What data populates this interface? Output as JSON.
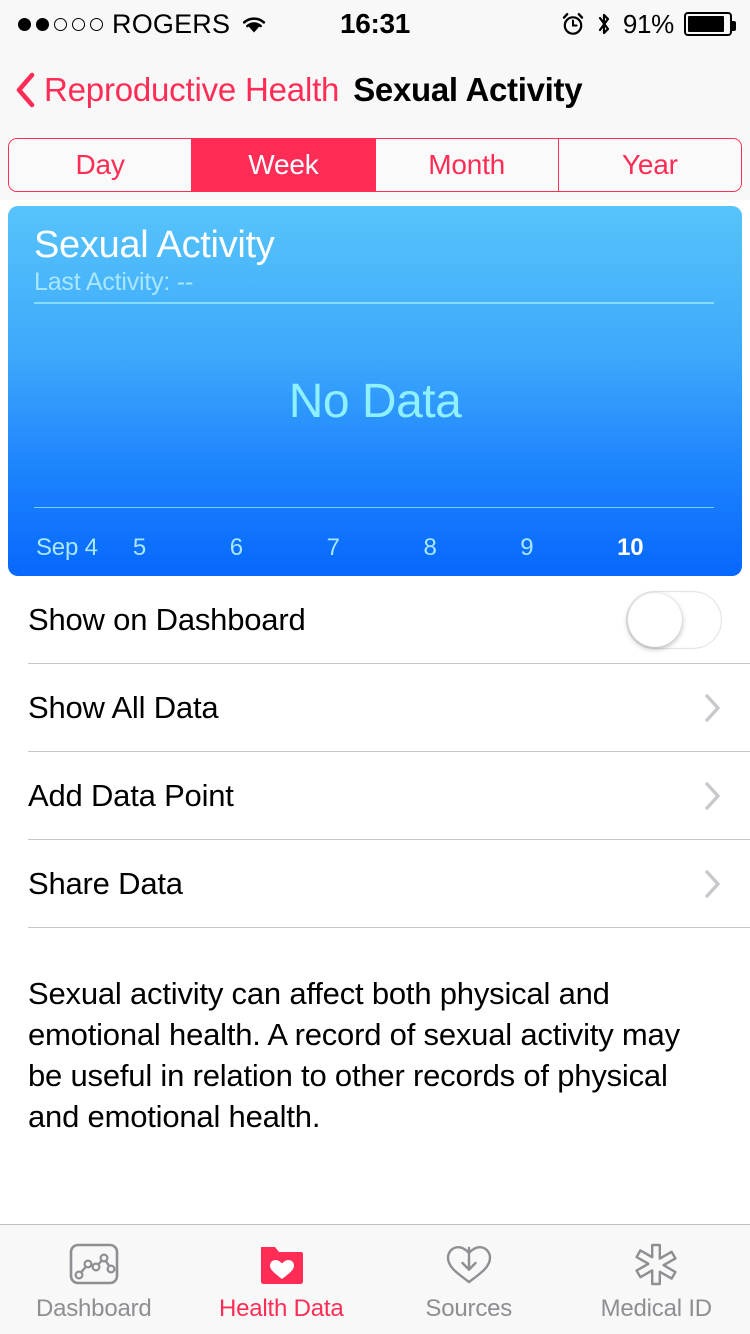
{
  "status_bar": {
    "carrier": "ROGERS",
    "signal_bars_filled": 2,
    "signal_bars_total": 5,
    "wifi_icon": "wifi-icon",
    "time": "16:31",
    "alarm_icon": "alarm-clock-icon",
    "bluetooth_icon": "bluetooth-icon",
    "battery_percent": "91%",
    "battery_level": 91
  },
  "nav": {
    "back_icon": "chevron-left-icon",
    "back_label": "Reproductive Health",
    "title": "Sexual Activity"
  },
  "segmented_control": {
    "options": [
      {
        "label": "Day",
        "selected": false
      },
      {
        "label": "Week",
        "selected": true
      },
      {
        "label": "Month",
        "selected": false
      },
      {
        "label": "Year",
        "selected": false
      }
    ],
    "selected": "Week"
  },
  "chart_card": {
    "title": "Sexual Activity",
    "subtitle": "Last Activity: --",
    "empty_message": "No Data",
    "gradient_top": "#57C4FB",
    "gradient_bottom": "#0668FD",
    "empty_text_color": "#8FF0FF"
  },
  "chart_data": {
    "type": "bar",
    "title": "Sexual Activity",
    "subtitle": "Last Activity: --",
    "categories": [
      "Sep 4",
      "5",
      "6",
      "7",
      "8",
      "9",
      "10"
    ],
    "values": [
      0,
      0,
      0,
      0,
      0,
      0,
      0
    ],
    "xlabel": "",
    "ylabel": "",
    "ylim": [
      0,
      0
    ],
    "grid": false,
    "legend": "none",
    "empty_state": "No Data",
    "highlighted_category": "10",
    "range": "Week"
  },
  "settings": {
    "rows": [
      {
        "label": "Show on Dashboard",
        "control": "toggle",
        "value": false
      },
      {
        "label": "Show All Data",
        "control": "chevron"
      },
      {
        "label": "Add Data Point",
        "control": "chevron"
      },
      {
        "label": "Share Data",
        "control": "chevron"
      }
    ]
  },
  "description": "Sexual activity can affect both physical and emotional health. A record of sexual activity may be useful in relation to other records of physical and emotional health.",
  "tab_bar": {
    "accent_color": "#FF2D55",
    "inactive_color": "#8e8e93",
    "tabs": [
      {
        "label": "Dashboard",
        "icon": "chart-square-icon",
        "active": false
      },
      {
        "label": "Health Data",
        "icon": "folder-heart-icon",
        "active": true
      },
      {
        "label": "Sources",
        "icon": "heart-download-icon",
        "active": false
      },
      {
        "label": "Medical ID",
        "icon": "star-of-life-icon",
        "active": false
      }
    ]
  }
}
